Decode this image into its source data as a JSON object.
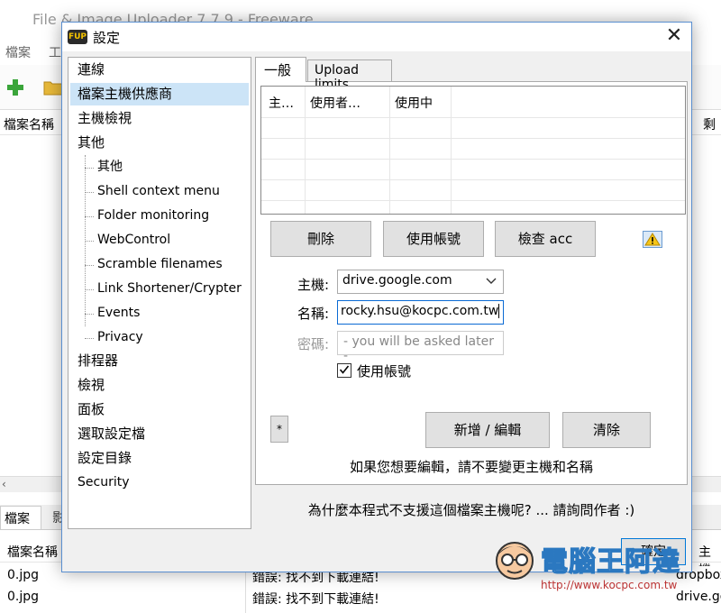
{
  "background_app": {
    "title": "File & Image Uploader 7.7.9 - Freeware",
    "menu": {
      "file": "檔案",
      "tools": "工"
    },
    "filelist": {
      "col_filename": "檔案名稱",
      "col_remain": "剩"
    },
    "donate_icon": "donate-icon",
    "bottom_tabs": {
      "files": "檔案",
      "second": "影"
    },
    "log": {
      "col_filename": "檔案名稱",
      "col_host": "主機",
      "rows": [
        {
          "file": "0.jpg",
          "message": "錯誤: 找不到下載連結!",
          "host": "dropbox"
        },
        {
          "file": "0.jpg",
          "message": "錯誤: 找不到下載連結!",
          "host": "drive.go"
        }
      ]
    }
  },
  "dialog": {
    "icon_text": "FUP",
    "title": "設定",
    "close_label": "✕",
    "tree": [
      {
        "label": "連線",
        "level": 0
      },
      {
        "label": "檔案主機供應商",
        "level": 0,
        "selected": true
      },
      {
        "label": "主機檢視",
        "level": 0
      },
      {
        "label": "其他",
        "level": 0
      },
      {
        "label": "其他",
        "level": 1
      },
      {
        "label": "Shell context menu",
        "level": 1
      },
      {
        "label": "Folder monitoring",
        "level": 1
      },
      {
        "label": "WebControl",
        "level": 1
      },
      {
        "label": "Scramble filenames",
        "level": 1
      },
      {
        "label": "Link Shortener/Crypter",
        "level": 1
      },
      {
        "label": "Events",
        "level": 1
      },
      {
        "label": "Privacy",
        "level": 1
      },
      {
        "label": "排程器",
        "level": 0
      },
      {
        "label": "檢視",
        "level": 0
      },
      {
        "label": "面板",
        "level": 0
      },
      {
        "label": "選取設定檔",
        "level": 0
      },
      {
        "label": "設定目錄",
        "level": 0
      },
      {
        "label": "Security",
        "level": 0
      }
    ],
    "tabs": {
      "general": "一般",
      "upload_limits": "Upload limits"
    },
    "accounts_table": {
      "headers": [
        "主…",
        "使用者…",
        "使用中"
      ]
    },
    "buttons": {
      "delete": "刪除",
      "use_account": "使用帳號",
      "check": "檢查 acc",
      "star": "*",
      "add_edit": "新增 / 編輯",
      "clear": "清除",
      "ok": "確定"
    },
    "warning_icon": "warning-icon",
    "form": {
      "host_label": "主機:",
      "host_value": "drive.google.com",
      "name_label": "名稱:",
      "name_value": "rocky.hsu@kocpc.com.tw",
      "password_label": "密碼:",
      "password_placeholder": "- you will be asked later -",
      "use_account_label": "使用帳號",
      "use_account_checked": true
    },
    "note_edit": "如果您想要編輯，請不要變更主機和名稱",
    "note_why": "為什麼本程式不支援這個檔案主機呢? ... 請詢問作者 :)"
  },
  "watermark": {
    "title": "電腦王阿達",
    "url": "http://www.kocpc.com.tw"
  }
}
